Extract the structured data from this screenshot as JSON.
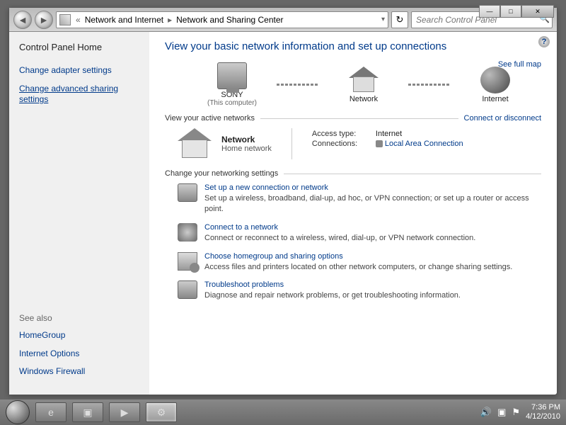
{
  "window_controls": {
    "min": "—",
    "max": "□",
    "close": "✕"
  },
  "breadcrumb": {
    "chevrons": "«",
    "path1": "Network and Internet",
    "path2": "Network and Sharing Center"
  },
  "search": {
    "placeholder": "Search Control Panel"
  },
  "sidebar": {
    "home": "Control Panel Home",
    "links": [
      "Change adapter settings",
      "Change advanced sharing settings"
    ],
    "see_also_heading": "See also",
    "see_also": [
      "HomeGroup",
      "Internet Options",
      "Windows Firewall"
    ]
  },
  "main": {
    "heading": "View your basic network information and set up connections",
    "full_map_link": "See full map",
    "nodes": {
      "pc_name": "SONY",
      "pc_sub": "(This computer)",
      "net": "Network",
      "internet": "Internet"
    },
    "active_row": {
      "left": "View your active networks",
      "right": "Connect or disconnect"
    },
    "active_net": {
      "name": "Network",
      "type": "Home network",
      "access_label": "Access type:",
      "access_value": "Internet",
      "conn_label": "Connections:",
      "conn_value": "Local Area Connection"
    },
    "change_heading": "Change your networking settings",
    "tasks": [
      {
        "title": "Set up a new connection or network",
        "desc": "Set up a wireless, broadband, dial-up, ad hoc, or VPN connection; or set up a router or access point."
      },
      {
        "title": "Connect to a network",
        "desc": "Connect or reconnect to a wireless, wired, dial-up, or VPN network connection."
      },
      {
        "title": "Choose homegroup and sharing options",
        "desc": "Access files and printers located on other network computers, or change sharing settings."
      },
      {
        "title": "Troubleshoot problems",
        "desc": "Diagnose and repair network problems, or get troubleshooting information."
      }
    ]
  },
  "taskbar": {
    "time": "7:36 PM",
    "date": "4/12/2010"
  }
}
